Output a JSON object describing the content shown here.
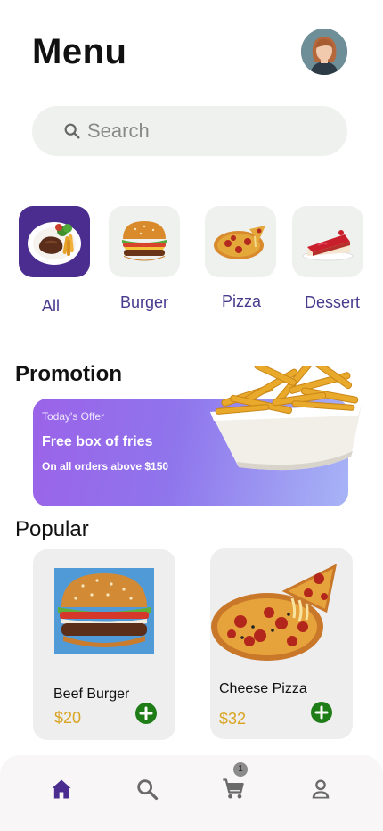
{
  "header": {
    "title": "Menu"
  },
  "search": {
    "placeholder": "Search"
  },
  "categories": [
    {
      "label": "All",
      "active": true,
      "icon": "plate-meal"
    },
    {
      "label": "Burger",
      "active": false,
      "icon": "burger"
    },
    {
      "label": "Pizza",
      "active": false,
      "icon": "pizza"
    },
    {
      "label": "Dessert",
      "active": false,
      "icon": "cake-slice"
    }
  ],
  "promotion": {
    "section_title": "Promotion",
    "kicker": "Today's Offer",
    "headline": "Free box of fries",
    "subtext": "On all orders above $150"
  },
  "popular": {
    "section_title": "Popular",
    "items": [
      {
        "name": "Beef Burger",
        "price": "$20"
      },
      {
        "name": "Cheese Pizza",
        "price": "$32"
      }
    ]
  },
  "bottom_nav": {
    "items": [
      {
        "icon": "home-icon",
        "active": true
      },
      {
        "icon": "search-icon",
        "active": false
      },
      {
        "icon": "cart-icon",
        "badge": "1",
        "active": false
      },
      {
        "icon": "profile-icon",
        "active": false
      }
    ]
  },
  "colors": {
    "accent": "#4b2d8f",
    "price": "#d9a422",
    "add_button": "#1f7d18",
    "promo_gradient_start": "#9b63e9",
    "promo_gradient_end": "#a7b4f6"
  }
}
